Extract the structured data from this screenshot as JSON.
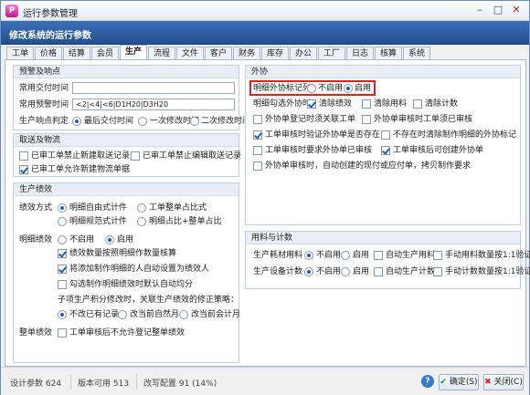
{
  "window": {
    "title": "运行参数管理",
    "icon": "app-logo-icon"
  },
  "header": {
    "title": "修改系统的运行参数"
  },
  "tabs": [
    "工单",
    "价格",
    "结算",
    "会员",
    "生产",
    "流程",
    "文件",
    "客户",
    "财务",
    "库存",
    "办公",
    "工厂",
    "日志",
    "核算",
    "系统"
  ],
  "active_tab": "生产",
  "left": {
    "warning": {
      "title": "预警及响点",
      "delivery_label": "常用交付时间",
      "delivery_value": "",
      "warning_label": "常用预警时间",
      "warning_value": "<2|<4|<6|D1H20|D3H20",
      "judge_label": "生产响点判定",
      "judge_options": [
        "最后交付时间",
        "一次修改时间",
        "二次修改时间"
      ]
    },
    "logistics": {
      "title": "取送及物流",
      "opt1": "已审工单禁止新建取送记录",
      "opt2": "已审工单禁止编辑取送记录",
      "opt3": "已审工单允许新建物流单据"
    },
    "perf": {
      "title": "生产绩效",
      "mode_label": "绩效方式",
      "mode_options": [
        "明细自由式计件",
        "工单整单占比式",
        "明细规范式计件",
        "明细占比+整单占比"
      ],
      "detail_label": "明细绩效",
      "detail_options": [
        "不启用",
        "启用"
      ],
      "sub1": "绩效数量按照明细作数量核算",
      "sub2": "将添加制作明细的人自动设置为绩效人",
      "sub3": "勾选制作明细绩效时默认自动均分",
      "strategy_label": "子项生产积分修改时，关联生产绩效的修正策略：",
      "strategy_options": [
        "不改已有记录",
        "改当前自然月",
        "改当前会计月"
      ],
      "whole_label": "整单绩效",
      "whole_opt": "工单审核后不允许登记整单绩效"
    }
  },
  "right": {
    "outsource": {
      "title": "外协",
      "mark_label": "明细外协标记列",
      "mark_options": [
        "不启用",
        "启用"
      ],
      "sel_label": "明细勾选外协时",
      "sel_opts": [
        "清除绩效",
        "清除用料",
        "清除计数"
      ],
      "r1a": "外协单登记时须关联工单",
      "r1b": "外协单审核时工单须已审核",
      "r2a": "工单审核时验证外协单是否存在",
      "r2b": "不存在时清除制作明细的外协标记",
      "r3a": "工单审核时要求外协单已审核",
      "r3b": "工单审核后可创建外协单",
      "r4": "外协单审核时，自动创建的现付或应付单，拷贝制作要求"
    },
    "material": {
      "title": "用料与计数",
      "use_label": "生产耗材用料",
      "use_options": [
        "不启用",
        "启用"
      ],
      "use_auto": "自动生产用料",
      "use_manual": "手动用料数量按1:1验证",
      "count_label": "生产设备计数",
      "count_options": [
        "不启用",
        "启用"
      ],
      "count_auto": "自动生产计数",
      "count_manual": "手动计数数量按1:1验证"
    }
  },
  "status": {
    "design": "设计参数 624",
    "version": "版本可用 513",
    "changed": "改写配置 91 (14%)",
    "ok_label": "确定(S)",
    "close_label": "关闭(C)",
    "help": "?"
  }
}
